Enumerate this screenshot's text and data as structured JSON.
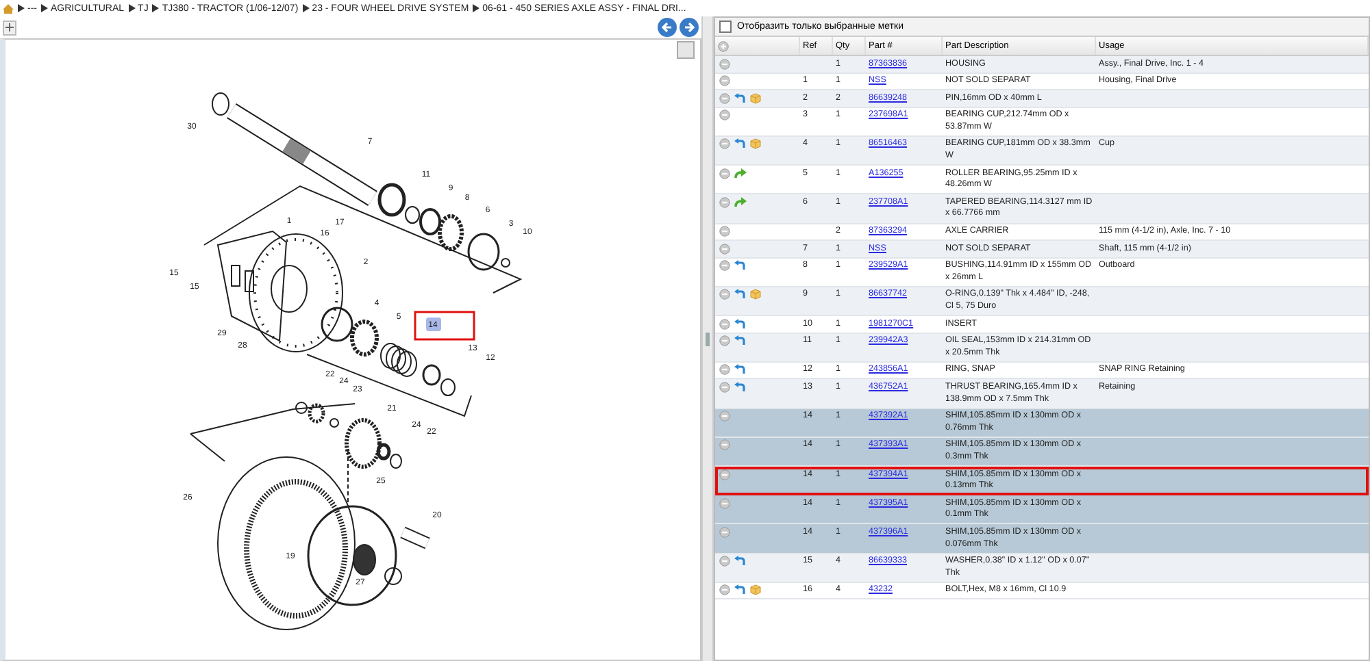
{
  "breadcrumb": [
    "---",
    "AGRICULTURAL",
    "TJ",
    "TJ380 - TRACTOR (1/06-12/07)",
    "23 - FOUR WHEEL DRIVE SYSTEM",
    "06-61 - 450 SERIES AXLE ASSY - FINAL DRI..."
  ],
  "diagram": {
    "callouts": [
      {
        "label": "30",
        "selected": false
      },
      {
        "label": "7",
        "selected": false
      },
      {
        "label": "11",
        "selected": false
      },
      {
        "label": "9",
        "selected": false
      },
      {
        "label": "8",
        "selected": false
      },
      {
        "label": "6",
        "selected": false
      },
      {
        "label": "3",
        "selected": false
      },
      {
        "label": "10",
        "selected": false
      },
      {
        "label": "1",
        "selected": false
      },
      {
        "label": "17",
        "selected": false
      },
      {
        "label": "16",
        "selected": false
      },
      {
        "label": "2",
        "selected": false
      },
      {
        "label": "15",
        "selected": false
      },
      {
        "label": "15",
        "selected": false
      },
      {
        "label": "4",
        "selected": false
      },
      {
        "label": "5",
        "selected": false
      },
      {
        "label": "14",
        "selected": true
      },
      {
        "label": "13",
        "selected": false
      },
      {
        "label": "12",
        "selected": false
      },
      {
        "label": "29",
        "selected": false
      },
      {
        "label": "28",
        "selected": false
      },
      {
        "label": "22",
        "selected": false
      },
      {
        "label": "24",
        "selected": false
      },
      {
        "label": "23",
        "selected": false
      },
      {
        "label": "21",
        "selected": false
      },
      {
        "label": "24",
        "selected": false
      },
      {
        "label": "22",
        "selected": false
      },
      {
        "label": "25",
        "selected": false
      },
      {
        "label": "26",
        "selected": false
      },
      {
        "label": "20",
        "selected": false
      },
      {
        "label": "19",
        "selected": false
      },
      {
        "label": "27",
        "selected": false
      }
    ]
  },
  "filter": {
    "label": "Отобразить только выбранные метки",
    "checked": false
  },
  "table": {
    "columns": [
      "Ref",
      "Qty",
      "Part #",
      "Part Description",
      "Usage"
    ],
    "rows": [
      {
        "return_arrow": false,
        "package": false,
        "forward_arrow": false,
        "ref": "",
        "qty": "1",
        "part": "87363836",
        "description": "HOUSING",
        "usage": "Assy., Final Drive, Inc. 1 - 4",
        "selected": false,
        "focused": false
      },
      {
        "return_arrow": false,
        "package": false,
        "forward_arrow": false,
        "ref": "1",
        "qty": "1",
        "part": "NSS",
        "description": "NOT SOLD SEPARAT",
        "usage": "Housing, Final Drive",
        "selected": false,
        "focused": false
      },
      {
        "return_arrow": true,
        "package": true,
        "forward_arrow": false,
        "ref": "2",
        "qty": "2",
        "part": "86639248",
        "description": "PIN,16mm OD x 40mm L",
        "usage": "",
        "selected": false,
        "focused": false
      },
      {
        "return_arrow": false,
        "package": false,
        "forward_arrow": false,
        "ref": "3",
        "qty": "1",
        "part": "237698A1",
        "description": "BEARING CUP,212.74mm OD x 53.87mm W",
        "usage": "",
        "selected": false,
        "focused": false
      },
      {
        "return_arrow": true,
        "package": true,
        "forward_arrow": false,
        "ref": "4",
        "qty": "1",
        "part": "86516463",
        "description": "BEARING CUP,181mm OD x 38.3mm W",
        "usage": "Cup",
        "selected": false,
        "focused": false
      },
      {
        "return_arrow": false,
        "package": false,
        "forward_arrow": true,
        "ref": "5",
        "qty": "1",
        "part": "A136255",
        "description": "ROLLER BEARING,95.25mm ID x 48.26mm W",
        "usage": "",
        "selected": false,
        "focused": false
      },
      {
        "return_arrow": false,
        "package": false,
        "forward_arrow": true,
        "ref": "6",
        "qty": "1",
        "part": "237708A1",
        "description": "TAPERED BEARING,114.3127 mm ID x 66.7766 mm",
        "usage": "",
        "selected": false,
        "focused": false
      },
      {
        "return_arrow": false,
        "package": false,
        "forward_arrow": false,
        "ref": "",
        "qty": "2",
        "part": "87363294",
        "description": "AXLE CARRIER",
        "usage": "115 mm (4-1/2 in), Axle, Inc. 7 - 10",
        "selected": false,
        "focused": false
      },
      {
        "return_arrow": false,
        "package": false,
        "forward_arrow": false,
        "ref": "7",
        "qty": "1",
        "part": "NSS",
        "description": "NOT SOLD SEPARAT",
        "usage": "Shaft, 115 mm (4-1/2 in)",
        "selected": false,
        "focused": false
      },
      {
        "return_arrow": true,
        "package": false,
        "forward_arrow": false,
        "ref": "8",
        "qty": "1",
        "part": "239529A1",
        "description": "BUSHING,114.91mm ID x 155mm OD x 26mm L",
        "usage": "Outboard",
        "selected": false,
        "focused": false
      },
      {
        "return_arrow": true,
        "package": true,
        "forward_arrow": false,
        "ref": "9",
        "qty": "1",
        "part": "86637742",
        "description": "O-RING,0.139\" Thk x 4.484\" ID, -248, Cl 5, 75 Duro",
        "usage": "",
        "selected": false,
        "focused": false
      },
      {
        "return_arrow": true,
        "package": false,
        "forward_arrow": false,
        "ref": "10",
        "qty": "1",
        "part": "1981270C1",
        "description": "INSERT",
        "usage": "",
        "selected": false,
        "focused": false
      },
      {
        "return_arrow": true,
        "package": false,
        "forward_arrow": false,
        "ref": "11",
        "qty": "1",
        "part": "239942A3",
        "description": "OIL SEAL,153mm ID x 214.31mm OD x 20.5mm Thk",
        "usage": "",
        "selected": false,
        "focused": false
      },
      {
        "return_arrow": true,
        "package": false,
        "forward_arrow": false,
        "ref": "12",
        "qty": "1",
        "part": "243856A1",
        "description": "RING, SNAP",
        "usage": "SNAP RING Retaining",
        "selected": false,
        "focused": false
      },
      {
        "return_arrow": true,
        "package": false,
        "forward_arrow": false,
        "ref": "13",
        "qty": "1",
        "part": "436752A1",
        "description": "THRUST BEARING,165.4mm ID x 138.9mm OD x 7.5mm Thk",
        "usage": "Retaining",
        "selected": false,
        "focused": false
      },
      {
        "return_arrow": false,
        "package": false,
        "forward_arrow": false,
        "ref": "14",
        "qty": "1",
        "part": "437392A1",
        "description": "SHIM,105.85mm ID x 130mm OD x 0.76mm Thk",
        "usage": "",
        "selected": true,
        "focused": false
      },
      {
        "return_arrow": false,
        "package": false,
        "forward_arrow": false,
        "ref": "14",
        "qty": "1",
        "part": "437393A1",
        "description": "SHIM,105.85mm ID x 130mm OD x 0.3mm Thk",
        "usage": "",
        "selected": true,
        "focused": false
      },
      {
        "return_arrow": false,
        "package": false,
        "forward_arrow": false,
        "ref": "14",
        "qty": "1",
        "part": "437394A1",
        "description": "SHIM,105.85mm ID x 130mm OD x 0.13mm Thk",
        "usage": "",
        "selected": true,
        "focused": true
      },
      {
        "return_arrow": false,
        "package": false,
        "forward_arrow": false,
        "ref": "14",
        "qty": "1",
        "part": "437395A1",
        "description": "SHIM,105.85mm ID x 130mm OD x 0.1mm Thk",
        "usage": "",
        "selected": true,
        "focused": false
      },
      {
        "return_arrow": false,
        "package": false,
        "forward_arrow": false,
        "ref": "14",
        "qty": "1",
        "part": "437396A1",
        "description": "SHIM,105.85mm ID x 130mm OD x 0.076mm Thk",
        "usage": "",
        "selected": true,
        "focused": false
      },
      {
        "return_arrow": true,
        "package": false,
        "forward_arrow": false,
        "ref": "15",
        "qty": "4",
        "part": "86639333",
        "description": "WASHER,0.38\" ID x 1.12\" OD x 0.07\" Thk",
        "usage": "",
        "selected": false,
        "focused": false
      },
      {
        "return_arrow": true,
        "package": true,
        "forward_arrow": false,
        "ref": "16",
        "qty": "4",
        "part": "43232",
        "description": "BOLT,Hex, M8 x 16mm, Cl 10.9",
        "usage": "",
        "selected": false,
        "focused": false
      }
    ]
  }
}
